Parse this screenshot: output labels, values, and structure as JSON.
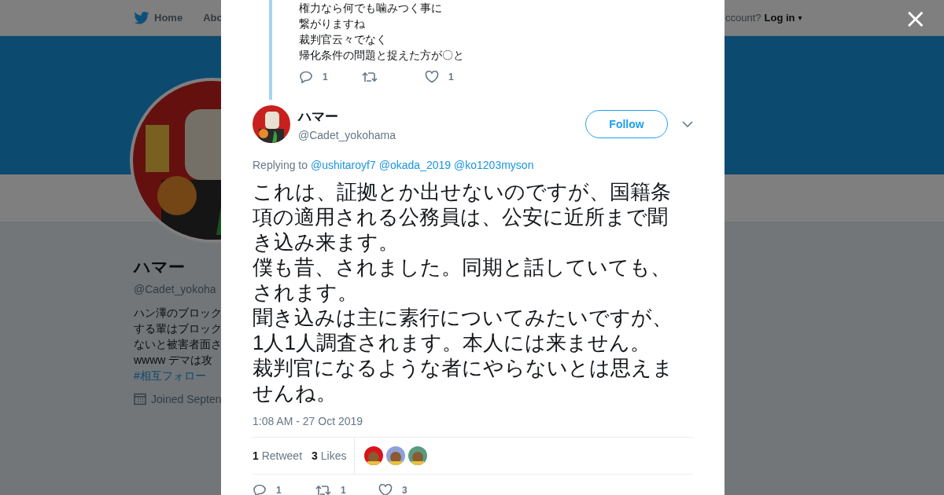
{
  "background_page": {
    "nav": {
      "items": [
        "Home",
        "Abo"
      ],
      "login_prompt": "ccount?",
      "login": "Log in",
      "login_caret": "▾"
    },
    "profile": {
      "name": "ハマー",
      "handle": "@Cadet_yokoha",
      "bio_lines": [
        "ハン澤のブロック",
        "する輩はブロック",
        "ないと被害者面さ",
        "wwww デマは攻"
      ],
      "hashtag": "#相互フォロー",
      "joined": "Joined Septen"
    }
  },
  "close_label": "×",
  "parent_tweet": {
    "lines": [
      "権力なら何でも噛みつく事に",
      "繋がりますね",
      "裁判官云々でなく",
      "帰化条件の問題と捉えた方が〇と"
    ],
    "actions": [
      {
        "kind": "reply",
        "count": "1"
      },
      {
        "kind": "retweet"
      },
      {
        "kind": "like",
        "count": "1"
      }
    ]
  },
  "tweet": {
    "name": "ハマー",
    "handle": "@Cadet_yokohama",
    "follow": "Follow",
    "replying_label": "Replying to",
    "replying_to": [
      "@ushitaroyf7",
      "@okada_2019",
      "@ko1203myson"
    ],
    "paragraphs": [
      "これは、証拠とか出せないのですが、国籍条項の適用される公務員は、公安に近所まで聞き込み来ます。",
      "僕も昔、されました。同期と話していても、されます。",
      "聞き込みは主に素行についてみたいですが、1人1人調査されます。本人には来ません。",
      "裁判官になるような者にやらないとは思えませんね。"
    ],
    "time": "1:08 AM - 27 Oct 2019",
    "stats": [
      {
        "count": "1",
        "label": "Retweet"
      },
      {
        "count": "3",
        "label": "Likes"
      }
    ],
    "likers": [
      {
        "color": "#d8141a"
      },
      {
        "color": "#8fa0d8"
      },
      {
        "color": "#5a9a80"
      }
    ],
    "actions": [
      {
        "kind": "reply",
        "count": "1"
      },
      {
        "kind": "retweet",
        "count": "1"
      },
      {
        "kind": "like",
        "count": "3"
      }
    ]
  }
}
